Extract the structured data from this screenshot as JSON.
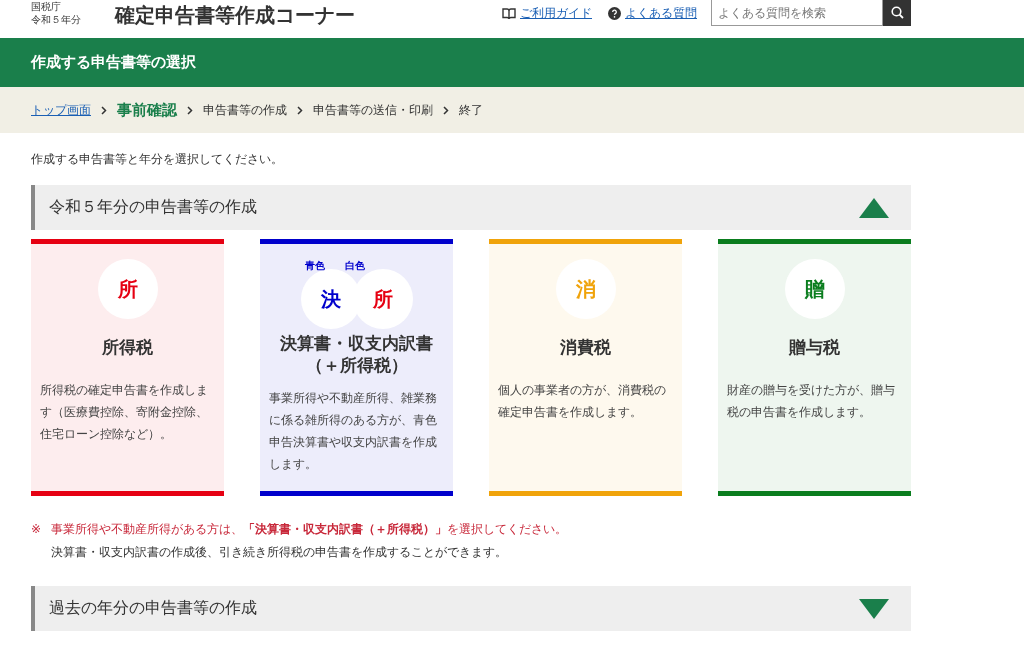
{
  "header": {
    "agency": "国税庁",
    "year": "令和５年分",
    "title": "確定申告書等作成コーナー",
    "links": [
      {
        "label": "ご利用ガイド",
        "kind": "book"
      },
      {
        "label": "よくある質問",
        "kind": "question"
      }
    ],
    "search": {
      "placeholder": "よくある質問を検索"
    }
  },
  "page_title": "作成する申告書等の選択",
  "breadcrumb": [
    {
      "label": "トップ画面",
      "kind": "link"
    },
    {
      "label": "事前確認",
      "kind": "current"
    },
    {
      "label": "申告書等の作成",
      "kind": "step"
    },
    {
      "label": "申告書等の送信・印刷",
      "kind": "step"
    },
    {
      "label": "終了",
      "kind": "step"
    }
  ],
  "intro": "作成する申告書等と年分を選択してください。",
  "sections": [
    {
      "title": "令和５年分の申告書等の作成",
      "expanded": true,
      "cards": [
        {
          "color": "#e60012",
          "badges": [
            {
              "char": "所",
              "color": "#e60012"
            }
          ],
          "title": "所得税",
          "description": "所得税の確定申告書を作成します（医療費控除、寄附金控除、住宅ローン控除など）。"
        },
        {
          "color": "#0000cc",
          "badges": [
            {
              "char": "決",
              "caption": "青色",
              "color": "#0000cc"
            },
            {
              "char": "所",
              "caption": "白色",
              "color": "#e60012"
            }
          ],
          "title": "決算書・収支内訳書（＋所得税）",
          "description": "事業所得や不動産所得、雑業務に係る雑所得のある方が、青色申告決算書や収支内訳書を作成します。"
        },
        {
          "color": "#f0a30a",
          "badges": [
            {
              "char": "消",
              "color": "#f0a30a"
            }
          ],
          "title": "消費税",
          "description": "個人の事業者の方が、消費税の確定申告書を作成します。"
        },
        {
          "color": "#0a7d1e",
          "badges": [
            {
              "char": "贈",
              "color": "#0a7d1e"
            }
          ],
          "title": "贈与税",
          "description": "財産の贈与を受けた方が、贈与税の申告書を作成します。"
        }
      ],
      "notes": [
        {
          "mark": "※",
          "text": "事業所得や不動産所得がある方は、**「決算書・収支内訳書（＋所得税）」**を選択してください。",
          "kind": "warning"
        },
        {
          "text": "決算書・収支内訳書の作成後、引き続き所得税の申告書を作成することができます。",
          "kind": "plain"
        }
      ]
    },
    {
      "title": "過去の年分の申告書等の作成",
      "expanded": false
    }
  ]
}
